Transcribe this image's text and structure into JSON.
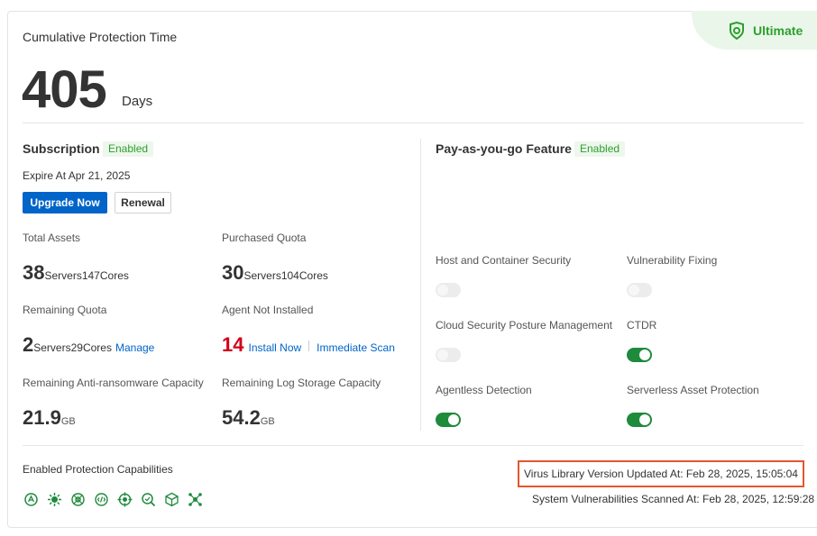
{
  "header": {
    "title": "Cumulative Protection Time",
    "days_value": "405",
    "days_unit": "Days",
    "edition": "Ultimate"
  },
  "subscription": {
    "title": "Subscription",
    "status": "Enabled",
    "expire": "Expire At Apr 21, 2025",
    "upgrade_label": "Upgrade Now",
    "renewal_label": "Renewal",
    "total_assets": {
      "label": "Total Assets",
      "servers": "38",
      "servers_unit": "Servers",
      "cores": "147",
      "cores_unit": "Cores"
    },
    "purchased_quota": {
      "label": "Purchased Quota",
      "servers": "30",
      "servers_unit": "Servers",
      "cores": "104",
      "cores_unit": "Cores"
    },
    "remaining_quota": {
      "label": "Remaining Quota",
      "servers": "2",
      "servers_unit": "Servers",
      "cores": "29",
      "cores_unit": "Cores",
      "manage_label": "Manage"
    },
    "agent_not_installed": {
      "label": "Agent Not Installed",
      "value": "14",
      "install_label": "Install Now",
      "scan_label": "Immediate Scan"
    },
    "anti_ransomware": {
      "label": "Remaining Anti-ransomware Capacity",
      "value": "21.9",
      "unit": "GB"
    },
    "log_storage": {
      "label": "Remaining Log Storage Capacity",
      "value": "54.2",
      "unit": "GB"
    }
  },
  "payg": {
    "title": "Pay-as-you-go Feature",
    "status": "Enabled",
    "features": [
      {
        "label": "Host and Container Security",
        "enabled": false
      },
      {
        "label": "Vulnerability Fixing",
        "enabled": false
      },
      {
        "label": "Cloud Security Posture Management",
        "enabled": false
      },
      {
        "label": "CTDR",
        "enabled": true
      },
      {
        "label": "Agentless Detection",
        "enabled": true
      },
      {
        "label": "Serverless Asset Protection",
        "enabled": true
      }
    ]
  },
  "capabilities": {
    "title": "Enabled Protection Capabilities",
    "icons": [
      "alert-shield-icon",
      "virus-icon",
      "network-icon",
      "code-icon",
      "target-icon",
      "search-scan-icon",
      "container-icon",
      "cluster-icon"
    ]
  },
  "footer": {
    "virus_library": "Virus Library Version Updated At: Feb 28, 2025, 15:05:04",
    "system_vuln": "System Vulnerabilities Scanned At: Feb 28, 2025, 12:59:28"
  },
  "colors": {
    "accent_green": "#2ca02c",
    "toggle_on": "#1e8a3c",
    "primary_blue": "#0064c8",
    "alert_red": "#d0021b",
    "highlight_border": "#e4572e"
  }
}
